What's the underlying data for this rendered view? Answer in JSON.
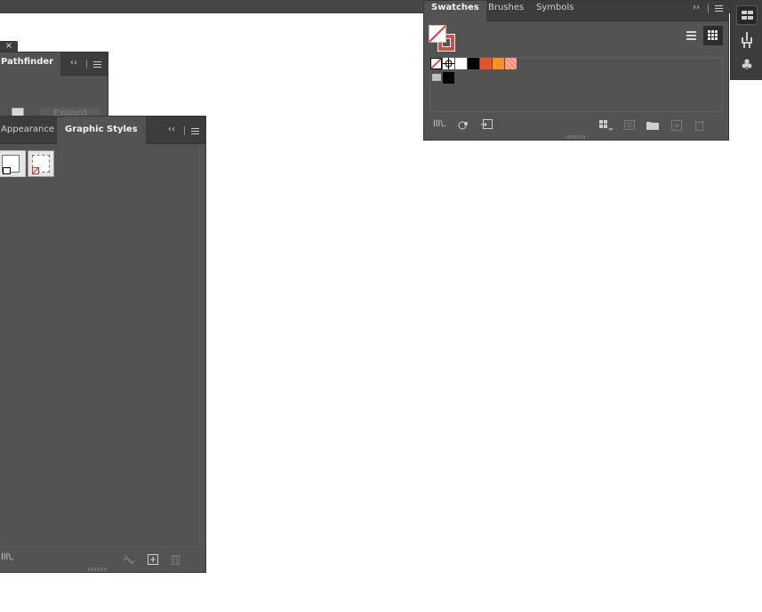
{
  "pathfinder_panel": {
    "close_glyph": "×",
    "tab_label": "Pathfinder",
    "collapse_glyph": "‹‹",
    "expand_button_label": "Expand"
  },
  "graphic_styles_panel": {
    "tabs": [
      {
        "label": "Appearance"
      },
      {
        "label": "Graphic Styles"
      }
    ],
    "collapse_glyph": "‹‹",
    "footer": {
      "library_glyph": "lll\\.",
      "break_link_icon": "break-link-icon",
      "new_style_icon": "new-style-icon",
      "delete_icon": "trash-icon"
    }
  },
  "swatches_panel": {
    "tabs": [
      {
        "label": "Swatches"
      },
      {
        "label": "Brushes"
      },
      {
        "label": "Symbols"
      }
    ],
    "expand_glyph": "››",
    "colors": {
      "black": "#000000",
      "white": "#ffffff",
      "red_orange": "#e8522b",
      "orange": "#f7931e",
      "salmon": "#f58b70",
      "none_red": "#d4201f"
    }
  },
  "dock": {
    "icons": [
      "swatches-dock-icon",
      "brushes-dock-icon",
      "symbols-dock-icon"
    ]
  }
}
